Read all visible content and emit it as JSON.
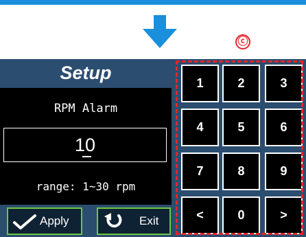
{
  "marker": {
    "label": "ⓒ"
  },
  "setup": {
    "title": "Setup",
    "parameter_label": "RPM Alarm",
    "value": "10",
    "range_text": "range: 1~30 rpm"
  },
  "buttons": {
    "apply_label": "Apply",
    "exit_label": "Exit",
    "apply_icon": "checkmark-icon",
    "exit_icon": "undo-arrow-icon"
  },
  "keypad": {
    "keys": [
      "1",
      "2",
      "3",
      "4",
      "5",
      "6",
      "7",
      "8",
      "9",
      "<",
      "0",
      ">"
    ]
  },
  "colors": {
    "accent_blue": "#1a8fdc",
    "screen_bg": "#2b4d6f",
    "highlight_red": "#e5252a",
    "button_border_green": "#6ec641"
  }
}
